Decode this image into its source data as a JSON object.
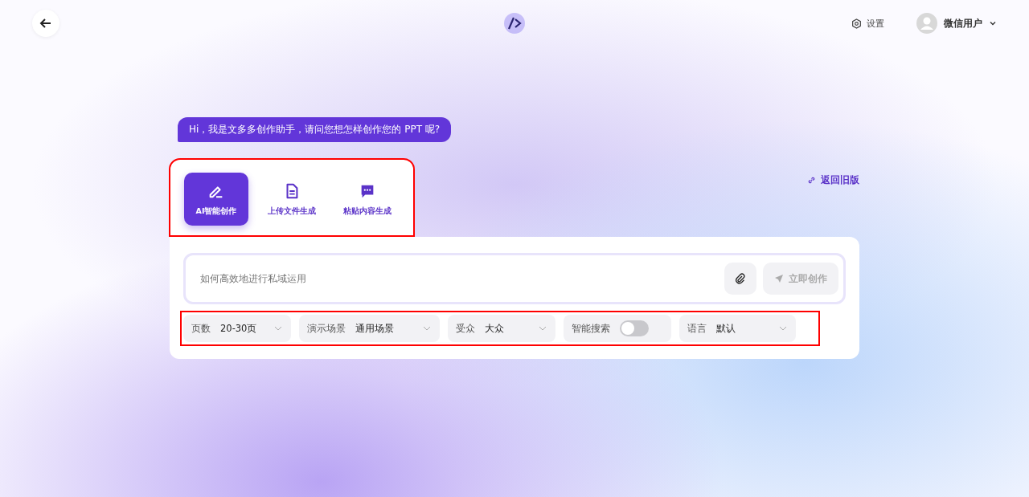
{
  "header": {
    "settings_label": "设置",
    "user_name": "微信用户"
  },
  "greeting": "Hi，我是文多多创作助手，请问您想怎样创作您的 PPT 呢?",
  "mode_tabs": [
    {
      "label": "AI智能创作",
      "selected": true,
      "kind": "pen"
    },
    {
      "label": "上传文件生成",
      "selected": false,
      "kind": "file"
    },
    {
      "label": "粘贴内容生成",
      "selected": false,
      "kind": "chat"
    }
  ],
  "old_version_link": "返回旧版",
  "prompt": {
    "placeholder": "如何高效地进行私域运用"
  },
  "submit_label": "立即创作",
  "options": [
    {
      "kind": "select",
      "label": "页数",
      "value": "20-30页"
    },
    {
      "kind": "select",
      "label": "演示场景",
      "value": "通用场景"
    },
    {
      "kind": "select",
      "label": "受众",
      "value": "大众"
    },
    {
      "kind": "toggle",
      "label": "智能搜索",
      "on": false
    },
    {
      "kind": "select",
      "label": "语言",
      "value": "默认"
    }
  ]
}
